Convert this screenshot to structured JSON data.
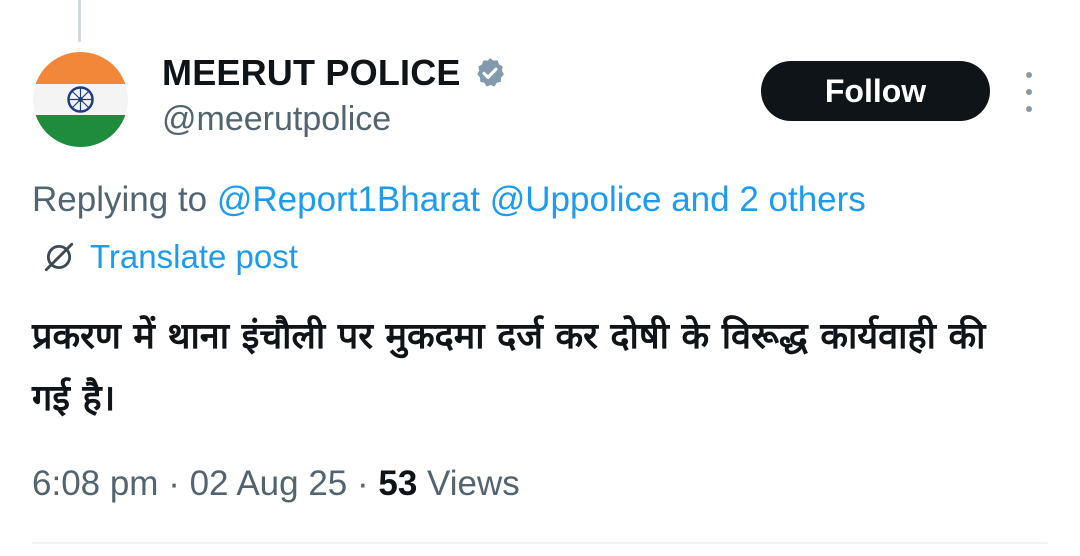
{
  "author": {
    "display_name": "MEERUT POLICE",
    "handle": "@meerutpolice",
    "verified_icon": "verified-badge-icon"
  },
  "follow_button": {
    "label": "Follow"
  },
  "more_icon": "more-vertical-icon",
  "reply_context": {
    "prefix": "Replying to",
    "mention_1": "@Report1Bharat",
    "mention_2": "@Uppolice",
    "suffix": "and 2 others"
  },
  "translate": {
    "icon": "translate-icon",
    "label": "Translate post"
  },
  "tweet": {
    "text": "प्रकरण में थाना इंचौली पर मुकदमा दर्ज कर दोषी के विरूद्ध कार्यवाही की गई है।"
  },
  "meta": {
    "time": "6:08 pm",
    "separator": "·",
    "date": "02 Aug 25",
    "views_count": "53",
    "views_label": "Views"
  },
  "colors": {
    "text_primary": "#0f1419",
    "text_secondary": "#536471",
    "link": "#1d9bf0",
    "button_bg": "#0f1419",
    "verified_badge": "#829aab"
  }
}
